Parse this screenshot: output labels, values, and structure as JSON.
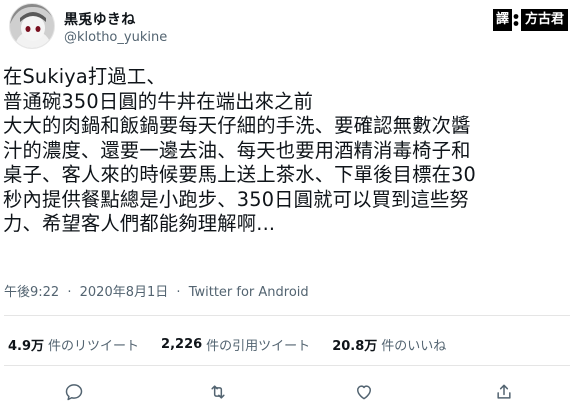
{
  "user": {
    "display_name": "黒兎ゆきね",
    "handle": "@klotho_yukine"
  },
  "badge": {
    "left": "譯",
    "right": "方古君"
  },
  "tweet": {
    "lines": [
      "在Sukiya打過工、",
      "普通碗350日圓的牛丼在端出來之前",
      "大大的肉鍋和飯鍋要每天仔細的手洗、要確認無數次醬",
      "汁的濃度、還要一邊去油、每天也要用酒精消毒椅子和",
      "桌子、客人來的時候要馬上送上茶水、下單後目標在30",
      "秒內提供餐點總是小跑步、350日圓就可以買到這些努",
      "力、希望客人們都能夠理解啊..."
    ]
  },
  "meta": {
    "time": "午後9:22",
    "separator": "·",
    "date": "2020年8月1日",
    "source": "Twitter for Android"
  },
  "stats": {
    "retweets_count": "4.9万",
    "retweets_label": "件のリツイート",
    "quotes_count": "2,226",
    "quotes_label": "件の引用ツイート",
    "likes_count": "20.8万",
    "likes_label": "件のいいね"
  },
  "actions": {
    "icons": [
      "reply-icon",
      "retweet-icon",
      "like-icon",
      "share-icon"
    ]
  },
  "colors": {
    "text": "#0f1419",
    "secondary": "#536471",
    "divider": "#e5e5e5"
  }
}
